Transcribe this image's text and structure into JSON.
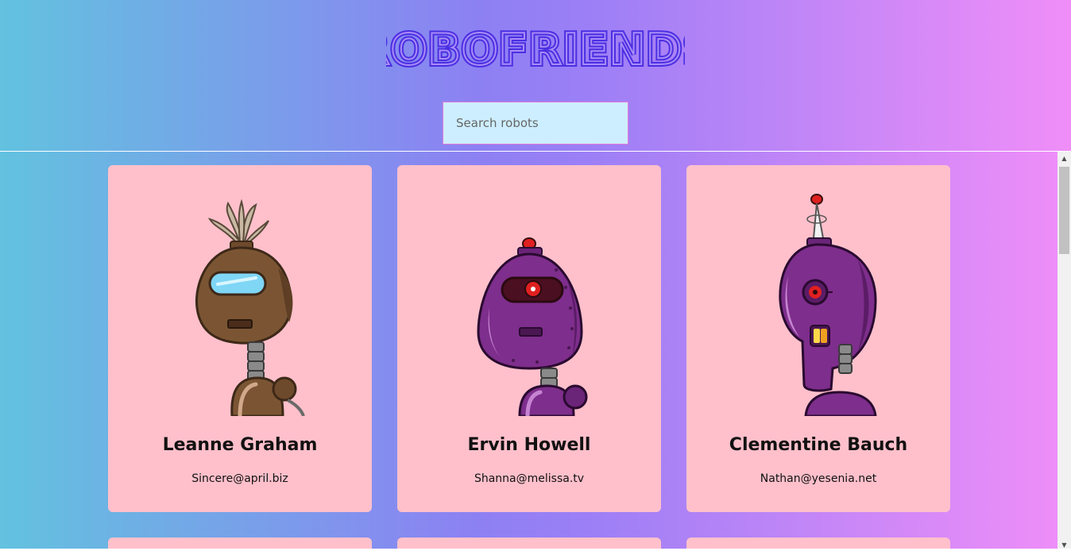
{
  "header": {
    "title": "ROBOFRIENDS",
    "title_color": "#4b2fe2"
  },
  "search": {
    "placeholder": "Search robots",
    "value": ""
  },
  "robots": [
    {
      "name": "Leanne Graham",
      "email": "Sincere@april.biz",
      "avatar_icon": "brown-robot-icon",
      "color": "#7b5533"
    },
    {
      "name": "Ervin Howell",
      "email": "Shanna@melissa.tv",
      "avatar_icon": "purple-robot-icon",
      "color": "#7e2e8c"
    },
    {
      "name": "Clementine Bauch",
      "email": "Nathan@yesenia.net",
      "avatar_icon": "purple-cyclops-robot-icon",
      "color": "#7e2e8c"
    }
  ],
  "theme": {
    "card_background": "#ffc0cb",
    "search_background": "#cdeeff",
    "gradient_start": "#62c2df",
    "gradient_end": "#f08ef8"
  }
}
